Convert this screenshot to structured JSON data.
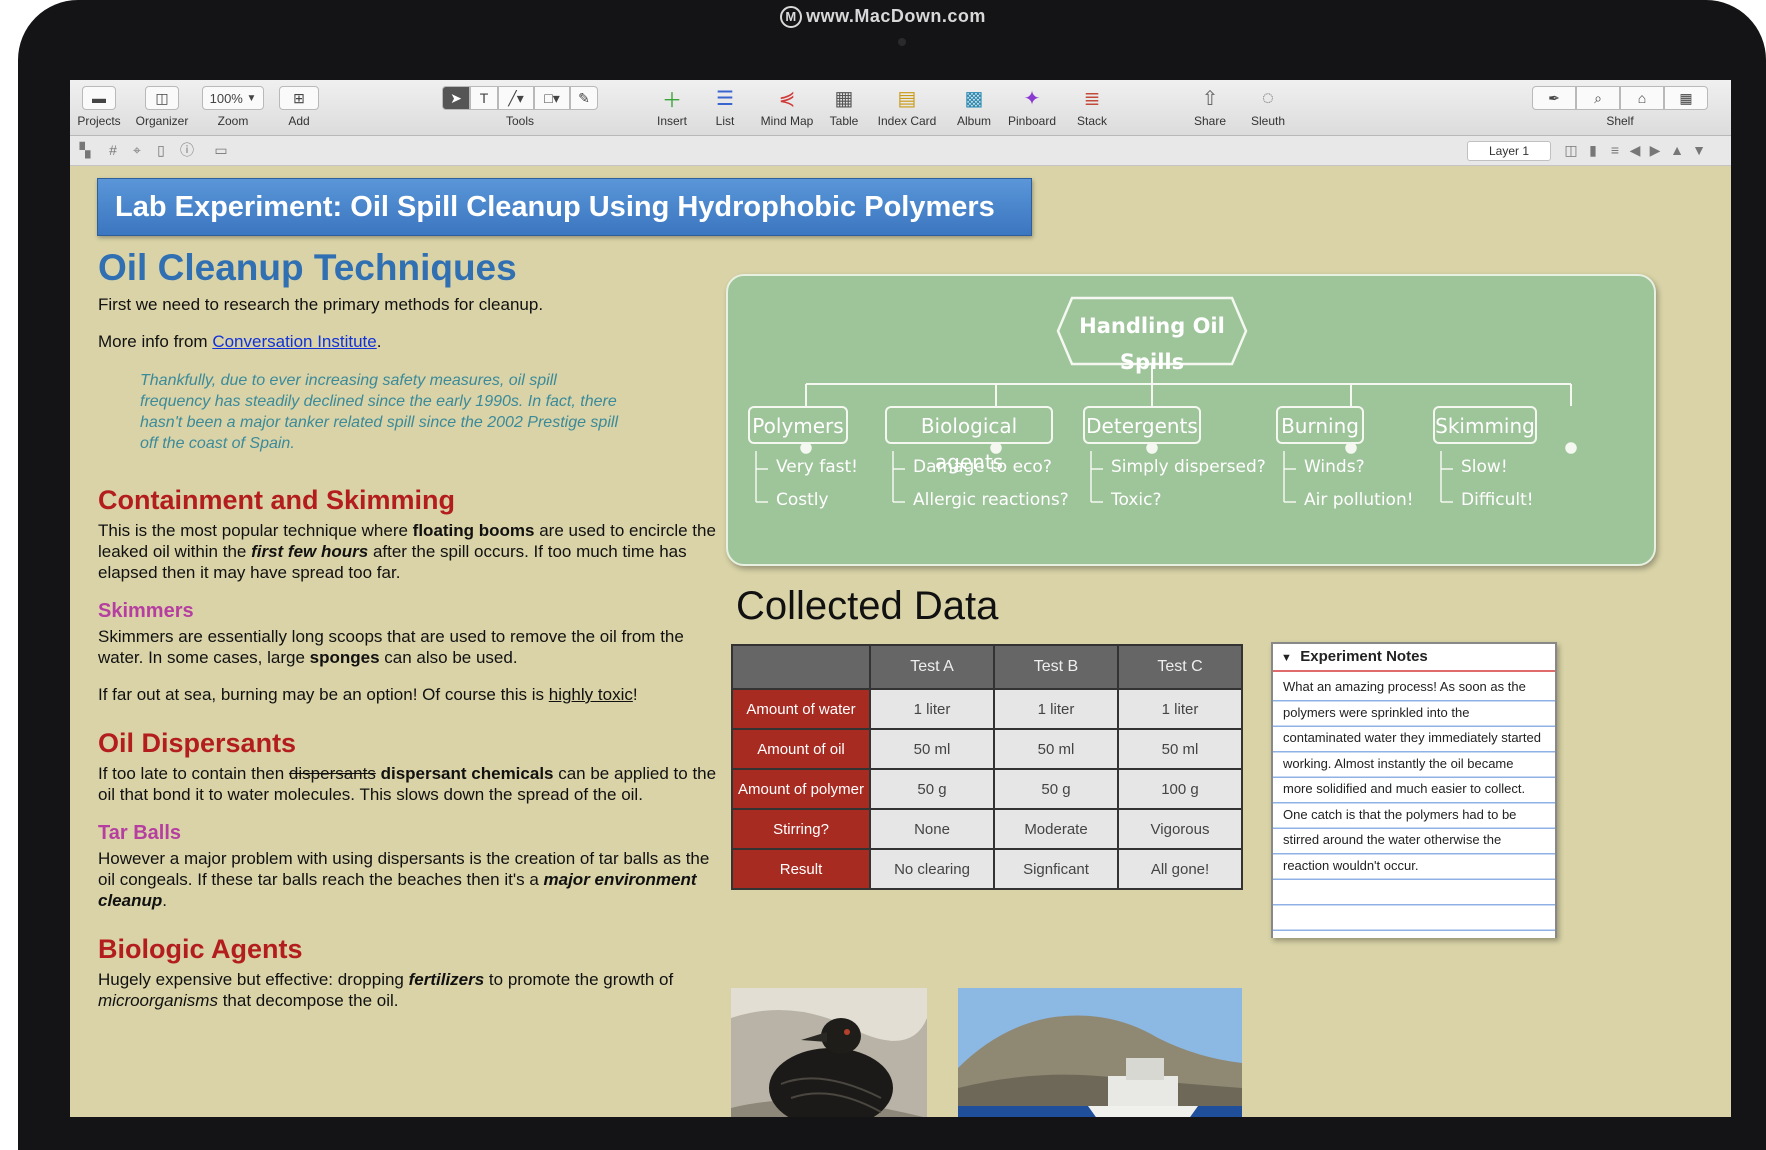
{
  "watermark": {
    "text": "www.MacDown.com"
  },
  "toolbar": {
    "projects": "Projects",
    "organizer": "Organizer",
    "zoom_value": "100%",
    "zoom": "Zoom",
    "add": "Add",
    "tools": "Tools",
    "insert": "Insert",
    "list": "List",
    "mind_map": "Mind Map",
    "table": "Table",
    "index_card": "Index Card",
    "album": "Album",
    "pinboard": "Pinboard",
    "stack": "Stack",
    "share": "Share",
    "sleuth": "Sleuth",
    "shelf": "Shelf"
  },
  "subbar": {
    "layer": "Layer 1"
  },
  "document": {
    "title": "Lab Experiment: Oil Spill Cleanup Using Hydrophobic Polymers",
    "h1": "Oil Cleanup Techniques",
    "intro": "First we need to research the primary methods for cleanup.",
    "more_info_prefix": "More info from ",
    "more_info_link": "Conversation Institute",
    "more_info_suffix": ".",
    "quote": "Thankfully, due to ever increasing safety measures, oil spill frequency has steadily declined since the early 1990s. In fact, there hasn't been a major tanker related spill since the 2002 Prestige spill off the coast of Spain.",
    "containment_heading": "Containment and Skimming",
    "containment_1": "This is the most popular technique where ",
    "containment_bold_1": "floating booms",
    "containment_2": " are used to encircle the leaked oil within the ",
    "containment_bold_2": "first few hours",
    "containment_3": " after the spill occurs. If too much time has elapsed then it may have spread too far.",
    "skimmers_heading": "Skimmers",
    "skimmers_1": "Skimmers are essentially long scoops that are used to remove the oil from the water. In some cases, large ",
    "skimmers_bold": "sponges",
    "skimmers_2": " can also be used.",
    "burning_1": "If far out at sea, burning may be an option! Of course this is ",
    "burning_underline": "highly toxic",
    "burning_2": "!",
    "dispersants_heading": "Oil Dispersants",
    "dispersants_1": "If too late to contain then ",
    "dispersants_strike": "dispersants",
    "dispersants_bold": " dispersant chemicals",
    "dispersants_2": " can be applied to the oil that bond it to water molecules. This slows down the spread of the oil.",
    "tarballs_heading": "Tar Balls",
    "tarballs_1": "However a major problem with using dispersants is the creation of tar balls as the oil congeals. If these tar balls reach the beaches then it's a ",
    "tarballs_bold": "major environment cleanup",
    "tarballs_2": ".",
    "biologic_heading": "Biologic Agents",
    "biologic_1": "Hugely expensive but effective: dropping ",
    "biologic_bold": "fertilizers",
    "biologic_2": " to promote the growth of ",
    "biologic_italic": "microorganisms",
    "biologic_3": " that decompose the oil."
  },
  "mindmap": {
    "root": "Handling Oil Spills",
    "branches": [
      {
        "label": "Polymers",
        "leaves": [
          "Very fast!",
          "Costly"
        ]
      },
      {
        "label": "Biological agents",
        "leaves": [
          "Damage to eco?",
          "Allergic reactions?"
        ]
      },
      {
        "label": "Detergents",
        "leaves": [
          "Simply dispersed?",
          "Toxic?"
        ]
      },
      {
        "label": "Burning",
        "leaves": [
          "Winds?",
          "Air pollution!"
        ]
      },
      {
        "label": "Skimming",
        "leaves": [
          "Slow!",
          "Difficult!"
        ]
      }
    ]
  },
  "collected": {
    "title": "Collected Data",
    "columns": [
      "Test A",
      "Test B",
      "Test C"
    ],
    "rows": [
      {
        "label": "Amount of water",
        "values": [
          "1 liter",
          "1 liter",
          "1 liter"
        ]
      },
      {
        "label": "Amount of oil",
        "values": [
          "50 ml",
          "50 ml",
          "50 ml"
        ]
      },
      {
        "label": "Amount of polymer",
        "values": [
          "50 g",
          "50 g",
          "100 g"
        ]
      },
      {
        "label": "Stirring?",
        "values": [
          "None",
          "Moderate",
          "Vigorous"
        ]
      },
      {
        "label": "Result",
        "values": [
          "No clearing",
          "Signficant",
          "All gone!"
        ]
      }
    ]
  },
  "notes": {
    "title": "Experiment Notes",
    "body": "What an amazing process! As soon as the polymers were sprinkled into the contaminated water they immediately started working. Almost instantly the oil became more solidified and much easier to collect. One catch is that the polymers had to be stirred around the water otherwise the reaction wouldn't occur."
  },
  "colors": {
    "accent_blue": "#3b76c0",
    "heading_red": "#b31d1d",
    "heading_pink": "#b63ea0",
    "mindmap_green": "#9ec49a",
    "row_header_red": "#a82b22"
  }
}
